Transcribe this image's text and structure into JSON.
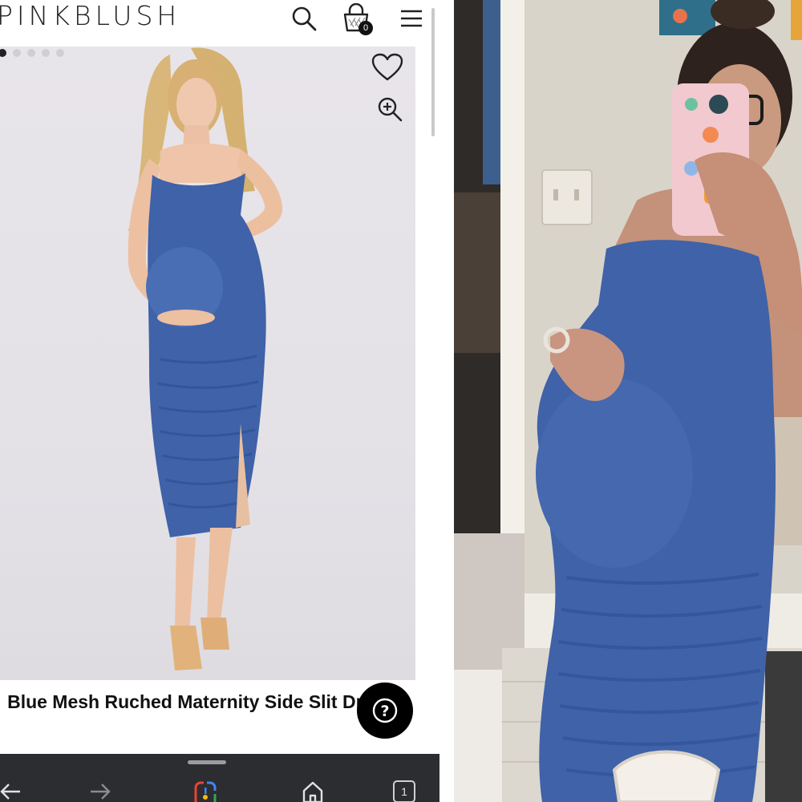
{
  "header": {
    "brand": "PINKBLUSH",
    "bag_count": "0",
    "icons": [
      "search-icon",
      "bag-icon",
      "menu-icon"
    ]
  },
  "gallery": {
    "image_count": 5,
    "active_index": 0,
    "icons": [
      "heart-icon",
      "zoom-in-icon"
    ]
  },
  "product": {
    "title": "Blue Mesh Ruched Maternity Side Slit Dress"
  },
  "help": {
    "icon": "question-icon",
    "label": "?"
  },
  "browser_bar": {
    "tab_count": "1",
    "icons": [
      "back-arrow-icon",
      "forward-arrow-icon",
      "google-lens-icon",
      "home-icon",
      "tabs-icon"
    ]
  },
  "colors": {
    "dress_blue": "#3f62a8",
    "header_text": "#222222",
    "browser_bar_bg": "#2b2d31",
    "help_button_bg": "#000000"
  }
}
